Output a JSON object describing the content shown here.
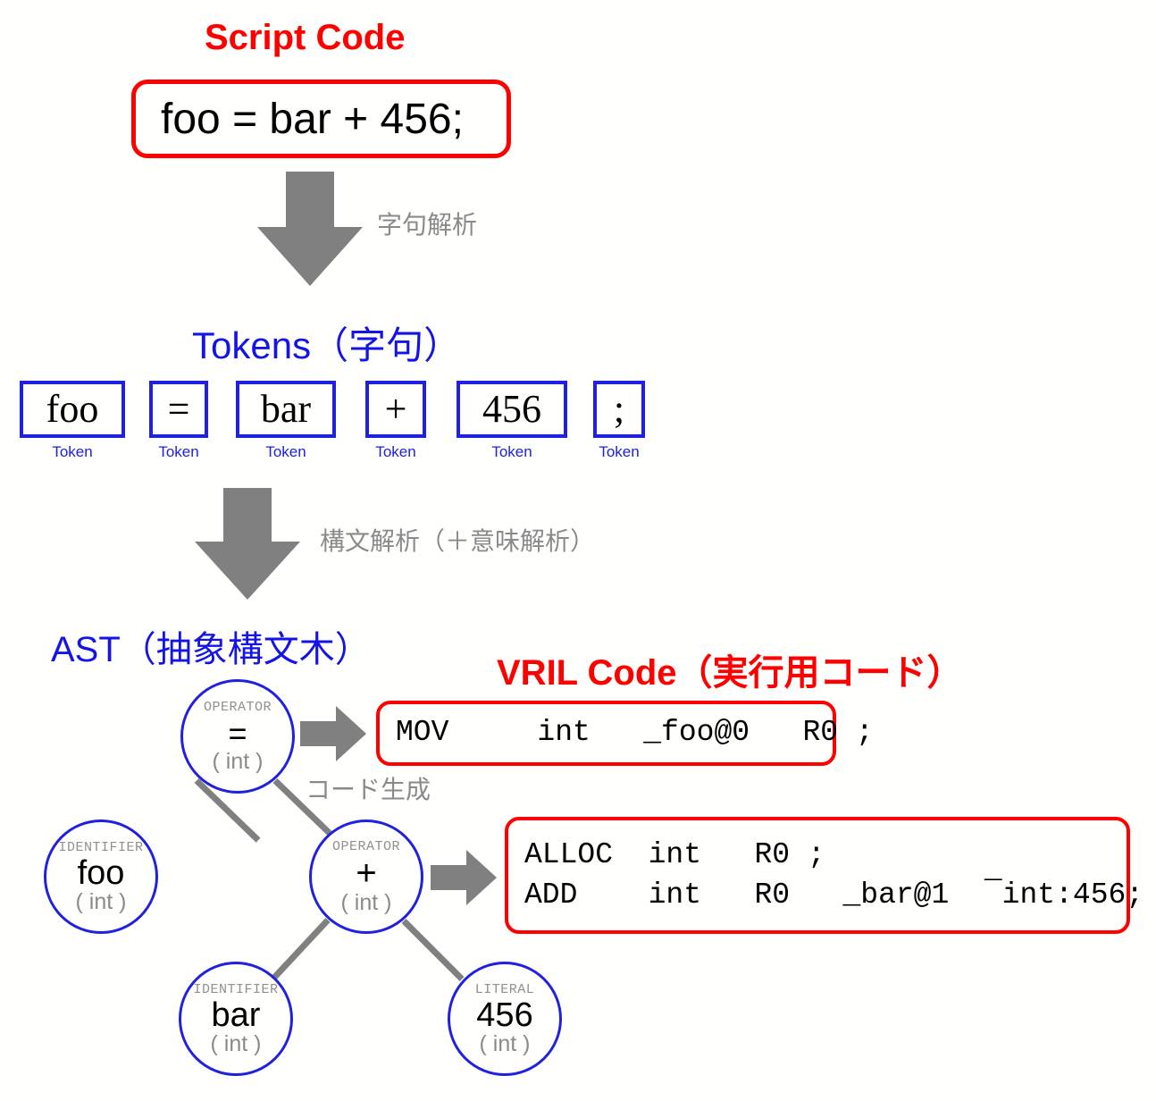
{
  "stages": {
    "script": {
      "title": "Script Code",
      "code": "foo = bar + 456;"
    },
    "lexing": {
      "label": "字句解析",
      "arrow_icon": "down-arrow-icon"
    },
    "tokens": {
      "title": "Tokens（字句）",
      "caption": "Token",
      "items": [
        {
          "text": "foo",
          "caption": "Token"
        },
        {
          "text": "=",
          "caption": "Token"
        },
        {
          "text": "bar",
          "caption": "Token"
        },
        {
          "text": "+",
          "caption": "Token"
        },
        {
          "text": "456",
          "caption": "Token"
        },
        {
          "text": ";",
          "caption": "Token"
        }
      ]
    },
    "parsing": {
      "label": "構文解析（＋意味解析）",
      "arrow_icon": "down-arrow-icon"
    },
    "ast": {
      "title": "AST（抽象構文木）",
      "nodes": [
        {
          "kind": "OPERATOR",
          "value": "=",
          "type": "( int )"
        },
        {
          "kind": "IDENTIFIER",
          "value": "foo",
          "type": "( int )"
        },
        {
          "kind": "OPERATOR",
          "value": "+",
          "type": "( int )"
        },
        {
          "kind": "IDENTIFIER",
          "value": "bar",
          "type": "( int )"
        },
        {
          "kind": "LITERAL",
          "value": "456",
          "type": "( int )"
        }
      ]
    },
    "codegen": {
      "label": "コード生成",
      "arrow_icon": "right-arrow-icon"
    },
    "vril": {
      "title": "VRIL Code（実行用コード）",
      "block1": {
        "lines": [
          "MOV     int   _foo@0   R0 ;"
        ]
      },
      "block2": {
        "lines": [
          "ALLOC  int   R0 ;",
          "ADD    int   R0   _bar@1  ¯int:456;"
        ]
      }
    }
  },
  "colors": {
    "red": "#ff0000",
    "blue": "#2020e0",
    "gray": "#808080",
    "label_gray": "#8a8a8a",
    "background": "#fffffd"
  }
}
